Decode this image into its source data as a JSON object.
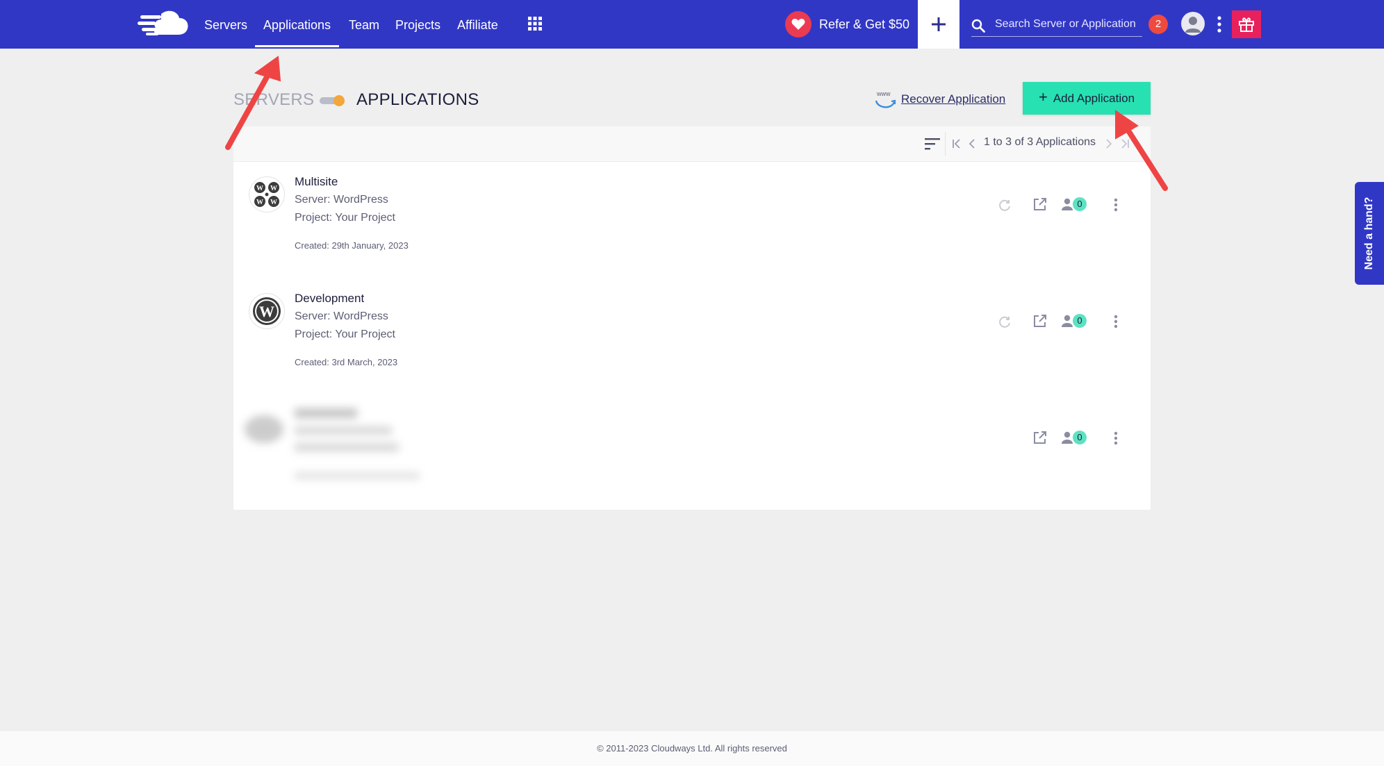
{
  "nav": {
    "items": [
      {
        "label": "Servers"
      },
      {
        "label": "Applications",
        "active": true
      },
      {
        "label": "Team"
      },
      {
        "label": "Projects"
      },
      {
        "label": "Affiliate"
      }
    ],
    "refer_label": "Refer & Get $50",
    "search_placeholder": "Search Server or Application",
    "notification_count": "2",
    "colors": {
      "nav_bg": "#3137c5",
      "refer_heart": "#ea3b52",
      "gift": "#e8215d",
      "notification": "#ef4a3f"
    }
  },
  "header": {
    "servers_label": "SERVERS",
    "applications_label": "APPLICATIONS",
    "recover_label": "Recover Application",
    "add_label": "Add Application",
    "colors": {
      "add_button": "#27e1b2",
      "toggle_knob": "#f3a73a"
    }
  },
  "pagination": {
    "text": "1 to 3 of 3 Applications"
  },
  "apps": [
    {
      "name": "Multisite",
      "server": "Server: WordPress",
      "project": "Project: Your Project",
      "created": "Created: 29th January, 2023",
      "team_count": "0",
      "logo": "multisite-wordpress-icon"
    },
    {
      "name": "Development",
      "server": "Server: WordPress",
      "project": "Project: Your Project",
      "created": "Created: 3rd March, 2023",
      "team_count": "0",
      "logo": "wordpress-icon"
    },
    {
      "team_count": "0"
    }
  ],
  "help_tab": "Need a hand?",
  "footer": "© 2011-2023 Cloudways Ltd. All rights reserved"
}
